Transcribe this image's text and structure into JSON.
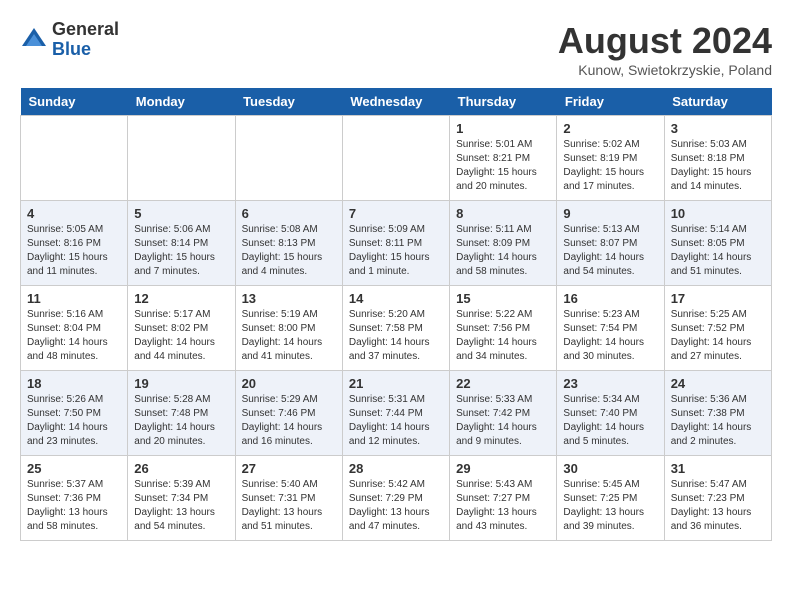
{
  "header": {
    "logo": {
      "general": "General",
      "blue": "Blue"
    },
    "title": "August 2024",
    "location": "Kunow, Swietokrzyskie, Poland"
  },
  "days_of_week": [
    "Sunday",
    "Monday",
    "Tuesday",
    "Wednesday",
    "Thursday",
    "Friday",
    "Saturday"
  ],
  "weeks": [
    [
      {
        "day": "",
        "info": ""
      },
      {
        "day": "",
        "info": ""
      },
      {
        "day": "",
        "info": ""
      },
      {
        "day": "",
        "info": ""
      },
      {
        "day": "1",
        "info": "Sunrise: 5:01 AM\nSunset: 8:21 PM\nDaylight: 15 hours and 20 minutes."
      },
      {
        "day": "2",
        "info": "Sunrise: 5:02 AM\nSunset: 8:19 PM\nDaylight: 15 hours and 17 minutes."
      },
      {
        "day": "3",
        "info": "Sunrise: 5:03 AM\nSunset: 8:18 PM\nDaylight: 15 hours and 14 minutes."
      }
    ],
    [
      {
        "day": "4",
        "info": "Sunrise: 5:05 AM\nSunset: 8:16 PM\nDaylight: 15 hours and 11 minutes."
      },
      {
        "day": "5",
        "info": "Sunrise: 5:06 AM\nSunset: 8:14 PM\nDaylight: 15 hours and 7 minutes."
      },
      {
        "day": "6",
        "info": "Sunrise: 5:08 AM\nSunset: 8:13 PM\nDaylight: 15 hours and 4 minutes."
      },
      {
        "day": "7",
        "info": "Sunrise: 5:09 AM\nSunset: 8:11 PM\nDaylight: 15 hours and 1 minute."
      },
      {
        "day": "8",
        "info": "Sunrise: 5:11 AM\nSunset: 8:09 PM\nDaylight: 14 hours and 58 minutes."
      },
      {
        "day": "9",
        "info": "Sunrise: 5:13 AM\nSunset: 8:07 PM\nDaylight: 14 hours and 54 minutes."
      },
      {
        "day": "10",
        "info": "Sunrise: 5:14 AM\nSunset: 8:05 PM\nDaylight: 14 hours and 51 minutes."
      }
    ],
    [
      {
        "day": "11",
        "info": "Sunrise: 5:16 AM\nSunset: 8:04 PM\nDaylight: 14 hours and 48 minutes."
      },
      {
        "day": "12",
        "info": "Sunrise: 5:17 AM\nSunset: 8:02 PM\nDaylight: 14 hours and 44 minutes."
      },
      {
        "day": "13",
        "info": "Sunrise: 5:19 AM\nSunset: 8:00 PM\nDaylight: 14 hours and 41 minutes."
      },
      {
        "day": "14",
        "info": "Sunrise: 5:20 AM\nSunset: 7:58 PM\nDaylight: 14 hours and 37 minutes."
      },
      {
        "day": "15",
        "info": "Sunrise: 5:22 AM\nSunset: 7:56 PM\nDaylight: 14 hours and 34 minutes."
      },
      {
        "day": "16",
        "info": "Sunrise: 5:23 AM\nSunset: 7:54 PM\nDaylight: 14 hours and 30 minutes."
      },
      {
        "day": "17",
        "info": "Sunrise: 5:25 AM\nSunset: 7:52 PM\nDaylight: 14 hours and 27 minutes."
      }
    ],
    [
      {
        "day": "18",
        "info": "Sunrise: 5:26 AM\nSunset: 7:50 PM\nDaylight: 14 hours and 23 minutes."
      },
      {
        "day": "19",
        "info": "Sunrise: 5:28 AM\nSunset: 7:48 PM\nDaylight: 14 hours and 20 minutes."
      },
      {
        "day": "20",
        "info": "Sunrise: 5:29 AM\nSunset: 7:46 PM\nDaylight: 14 hours and 16 minutes."
      },
      {
        "day": "21",
        "info": "Sunrise: 5:31 AM\nSunset: 7:44 PM\nDaylight: 14 hours and 12 minutes."
      },
      {
        "day": "22",
        "info": "Sunrise: 5:33 AM\nSunset: 7:42 PM\nDaylight: 14 hours and 9 minutes."
      },
      {
        "day": "23",
        "info": "Sunrise: 5:34 AM\nSunset: 7:40 PM\nDaylight: 14 hours and 5 minutes."
      },
      {
        "day": "24",
        "info": "Sunrise: 5:36 AM\nSunset: 7:38 PM\nDaylight: 14 hours and 2 minutes."
      }
    ],
    [
      {
        "day": "25",
        "info": "Sunrise: 5:37 AM\nSunset: 7:36 PM\nDaylight: 13 hours and 58 minutes."
      },
      {
        "day": "26",
        "info": "Sunrise: 5:39 AM\nSunset: 7:34 PM\nDaylight: 13 hours and 54 minutes."
      },
      {
        "day": "27",
        "info": "Sunrise: 5:40 AM\nSunset: 7:31 PM\nDaylight: 13 hours and 51 minutes."
      },
      {
        "day": "28",
        "info": "Sunrise: 5:42 AM\nSunset: 7:29 PM\nDaylight: 13 hours and 47 minutes."
      },
      {
        "day": "29",
        "info": "Sunrise: 5:43 AM\nSunset: 7:27 PM\nDaylight: 13 hours and 43 minutes."
      },
      {
        "day": "30",
        "info": "Sunrise: 5:45 AM\nSunset: 7:25 PM\nDaylight: 13 hours and 39 minutes."
      },
      {
        "day": "31",
        "info": "Sunrise: 5:47 AM\nSunset: 7:23 PM\nDaylight: 13 hours and 36 minutes."
      }
    ]
  ]
}
